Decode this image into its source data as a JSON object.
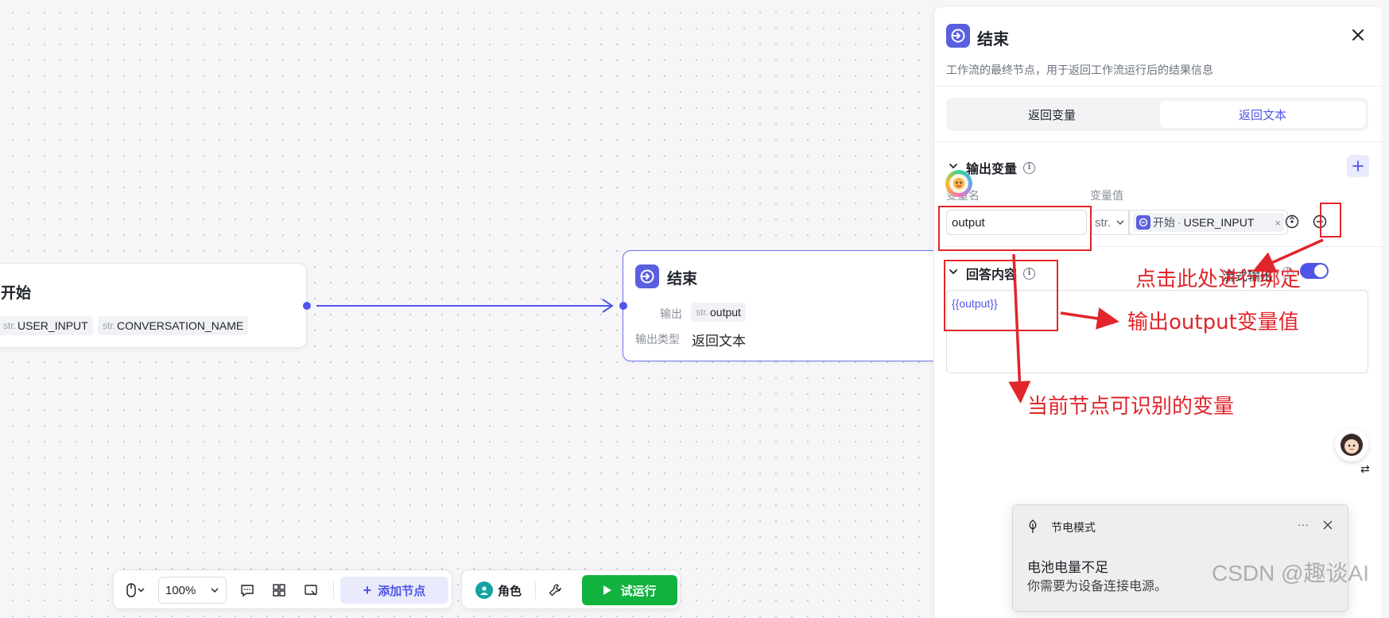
{
  "start_node": {
    "title": "开始",
    "vars": [
      {
        "type": "str.",
        "name": "USER_INPUT"
      },
      {
        "type": "str.",
        "name": "CONVERSATION_NAME"
      }
    ]
  },
  "end_node": {
    "title": "结束",
    "output_label": "输出",
    "output_type_label": "输出类型",
    "output_chip_type": "str.",
    "output_chip_name": "output",
    "output_type_value": "返回文本"
  },
  "panel": {
    "title": "结束",
    "description": "工作流的最终节点，用于返回工作流运行后的结果信息",
    "tabs": [
      "返回变量",
      "返回文本"
    ],
    "active_tab": 1,
    "output_vars_title": "输出变量",
    "col_var_name": "变量名",
    "col_var_value": "变量值",
    "var_name_value": "output",
    "var_type": "str.",
    "ref_source": "开始",
    "ref_sep": "·",
    "ref_var": "USER_INPUT",
    "answer_title": "回答内容",
    "stream_label": "流式输出",
    "answer_content": "{{output}}"
  },
  "annotations": {
    "bind_hint": "点击此处进行绑定",
    "output_hint": "输出output变量值",
    "vars_hint": "当前节点可识别的变量"
  },
  "toolbar": {
    "zoom": "100%",
    "add_node": "添加节点",
    "role": "角色",
    "run": "试运行"
  },
  "toast": {
    "title": "节电模式",
    "heading": "电池电量不足",
    "body": "你需要为设备连接电源。",
    "more": "···"
  },
  "watermark": "CSDN @趣谈AI",
  "colors": {
    "accent": "#4f55e8",
    "run_green": "#12b23f",
    "annotation_red": "#e0262b"
  }
}
